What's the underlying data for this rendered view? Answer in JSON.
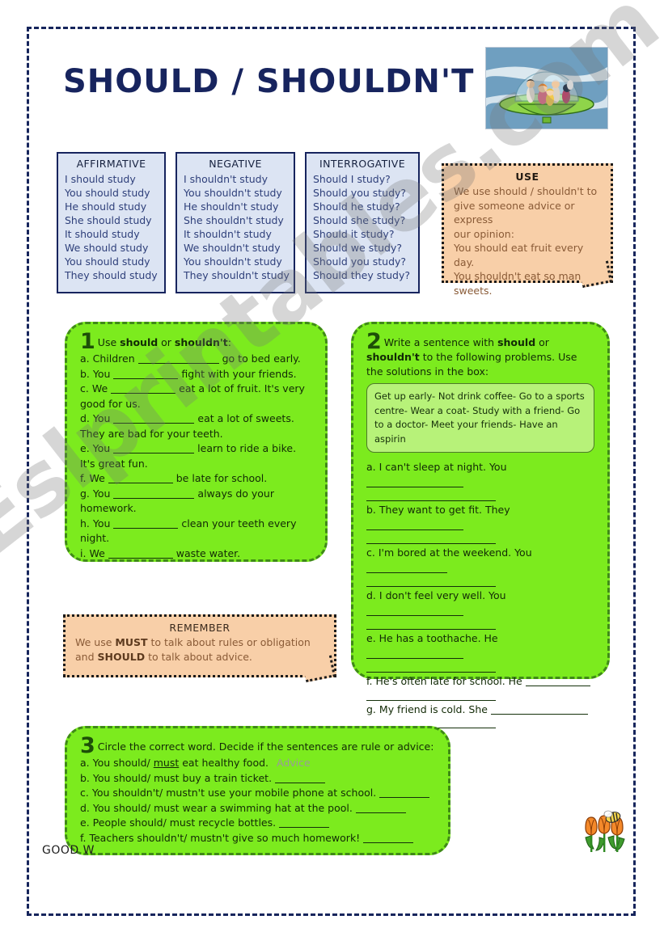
{
  "page": {
    "title": "SHOULD / SHOULDN'T",
    "footer_note": "GOOD W",
    "hero_image_name": "jetsons-flying-saucer-illustration",
    "tulips_image_name": "tulips-and-bee-illustration",
    "watermark": "Eslprintables.com",
    "colors": {
      "title": "#17245e",
      "page_border": "#16255c",
      "table_bg": "#dce4f3",
      "table_border": "#17245e",
      "peach_bg": "#f8cfa8",
      "green_bg": "#7ceb1e",
      "green_border": "#3f8a17",
      "solutions_bg": "#b7f279"
    }
  },
  "tables": [
    {
      "header": "AFFIRMATIVE",
      "rows": [
        "I should study",
        "You should study",
        "He should study",
        "She should study",
        "It should study",
        "We should study",
        "You should study",
        "They should study"
      ]
    },
    {
      "header": "NEGATIVE",
      "rows": [
        "I shouldn't study",
        "You shouldn't study",
        "He shouldn't study",
        "She shouldn't study",
        "It shouldn't study",
        "We shouldn't study",
        "You shouldn't study",
        "They shouldn't study"
      ]
    },
    {
      "header": "INTERROGATIVE",
      "rows": [
        "Should I study?",
        "Should you study?",
        "Should he study?",
        "Should she study?",
        "Should it study?",
        "Should we study?",
        "Should you study?",
        "Should they study?"
      ]
    }
  ],
  "use_box": {
    "header": "USE",
    "line1": "We use should / shouldn't to",
    "line2": "give someone advice or express",
    "line3": "our opinion:",
    "line4": "You should eat fruit every day.",
    "line5": "You shouldn't eat so many",
    "line6": "sweets."
  },
  "remember_box": {
    "header": "REMEMBER",
    "text_a": "We use ",
    "bold_a": "MUST",
    "text_b": " to talk about rules or obligation and ",
    "bold_b": "SHOULD",
    "text_c": " to talk about advice."
  },
  "exercise1": {
    "number": "1",
    "instruction_a": "Use ",
    "instruction_bold1": "should",
    "instruction_b": " or ",
    "instruction_bold2": "shouldn't",
    "instruction_c": ":",
    "items": [
      {
        "label": "a.",
        "before": "Children",
        "after": "go to bed early."
      },
      {
        "label": "b.",
        "before": "You",
        "after": "fight with your friends."
      },
      {
        "label": "c.",
        "before": "We",
        "after": "eat a lot of fruit. It's very good for us."
      },
      {
        "label": "d.",
        "before": "You",
        "after": "eat a lot of sweets. They are bad for your teeth."
      },
      {
        "label": "e.",
        "before": "You",
        "after": "learn to ride a bike. It's great fun."
      },
      {
        "label": "f.",
        "before": "We",
        "after": "be late for school."
      },
      {
        "label": "g.",
        "before": "You",
        "after": "always do your homework."
      },
      {
        "label": "h.",
        "before": "You",
        "after": "clean your teeth every night."
      },
      {
        "label": "i.",
        "before": "We",
        "after": "waste water."
      }
    ]
  },
  "exercise2": {
    "number": "2",
    "instruction_a": "Write a sentence with ",
    "instruction_bold1": "should",
    "instruction_b": " or ",
    "instruction_bold2": "shouldn't",
    "instruction_c": " to the following problems. Use the solutions in the box:",
    "solutions": "Get up early- Not drink coffee- Go to a sports centre- Wear a coat-  Study with a friend- Go to a doctor- Meet your friends- Have an aspirin",
    "items": [
      {
        "label": "a.",
        "text": "I can't sleep at night. You"
      },
      {
        "label": "b.",
        "text": "They want to get fit. They"
      },
      {
        "label": "c.",
        "text": "I'm bored at the weekend. You"
      },
      {
        "label": "d.",
        "text": "I don't feel very well. You"
      },
      {
        "label": "e.",
        "text": "He has a toothache. He"
      },
      {
        "label": "f.",
        "text": "He's often late for school. He"
      },
      {
        "label": "g.",
        "text": "My friend is cold. She"
      }
    ]
  },
  "exercise3": {
    "number": "3",
    "instruction": "Circle the correct word. Decide if the sentences are rule or advice:",
    "items": [
      {
        "label": "a.",
        "pre": "You should/ ",
        "choice": "must",
        "post": " eat healthy food.",
        "answer": "Advice",
        "has_blank": false
      },
      {
        "label": "b.",
        "pre": "You should/ must buy a train ticket.",
        "choice": "",
        "post": "",
        "answer": "",
        "has_blank": true
      },
      {
        "label": "c.",
        "pre": "You shouldn't/ mustn't use your mobile phone at school.",
        "choice": "",
        "post": "",
        "answer": "",
        "has_blank": true
      },
      {
        "label": "d.",
        "pre": "You should/ must wear a swimming hat at the pool.",
        "choice": "",
        "post": "",
        "answer": "",
        "has_blank": true
      },
      {
        "label": "e.",
        "pre": "People should/ must recycle bottles.",
        "choice": "",
        "post": "",
        "answer": "",
        "has_blank": true
      },
      {
        "label": "f.",
        "pre": "Teachers shouldn't/ mustn't give so much homework!",
        "choice": "",
        "post": "",
        "answer": "",
        "has_blank": true
      }
    ]
  }
}
